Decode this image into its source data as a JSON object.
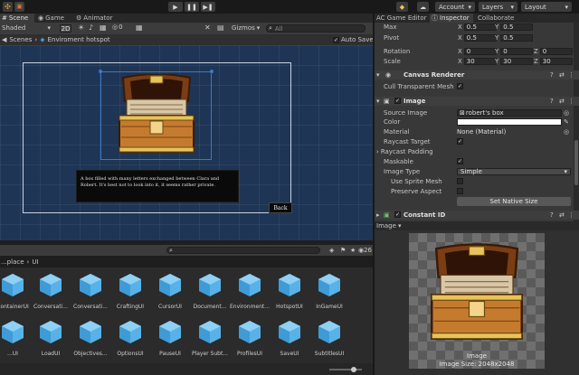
{
  "colors": {
    "accent": "#3a79c4",
    "scene_bg": "#1f3555",
    "panel": "#383838",
    "folder_blue": "#58b2e8"
  },
  "toolbar": {
    "account": "Account",
    "layers": "Layers",
    "layout": "Layout"
  },
  "scene_tabs": {
    "scene": "Scene",
    "game": "Game",
    "animator": "Animator"
  },
  "scene_toolbar": {
    "shading": "Shaded",
    "mode_2d": "2D",
    "hidden_count": "0",
    "gizmos": "Gizmos",
    "search_placeholder": "All"
  },
  "breadcrumb": {
    "scenes": "Scenes",
    "object": "Enviroment hotspot",
    "auto_save": "Auto Save"
  },
  "viewport": {
    "description": "A box filled with many letters exchanged between Clara and Robert. It's best not to look into it, it seems rather private.",
    "back_button": "Back"
  },
  "project": {
    "path_root": "...place",
    "path_child": "UI",
    "count": "26",
    "row1": [
      "ContainerUI",
      "Conversati...",
      "Conversati...",
      "CraftingUI",
      "CursorUI",
      "Document...",
      "Environment...",
      "HotspotUI",
      "InGameUI"
    ],
    "row2": [
      "...UI",
      "LoadUI",
      "Objectives...",
      "OptionsUI",
      "PauseUI",
      "Player Subt...",
      "ProfilesUI",
      "SaveUI",
      "SubtitlesUI"
    ]
  },
  "inspector_tabs": {
    "editor": "AC Game Editor",
    "inspector": "Inspector",
    "collab": "Collaborate"
  },
  "transform": {
    "max_label": "Max",
    "max_x": "0.5",
    "max_y": "0.5",
    "pivot_label": "Pivot",
    "pivot_x": "0.5",
    "pivot_y": "0.5",
    "rotation_label": "Rotation",
    "rot_x": "0",
    "rot_y": "0",
    "rot_z": "0",
    "scale_label": "Scale",
    "scale_x": "30",
    "scale_y": "30",
    "scale_z": "30",
    "x": "X",
    "y": "Y",
    "z": "Z"
  },
  "canvas_renderer": {
    "title": "Canvas Renderer",
    "cull_label": "Cull Transparent Mesh"
  },
  "image": {
    "title": "Image",
    "source_label": "Source Image",
    "source_value": "robert's box",
    "color_label": "Color",
    "material_label": "Material",
    "material_value": "None (Material)",
    "raycast_label": "Raycast Target",
    "padding_label": "Raycast Padding",
    "maskable_label": "Maskable",
    "type_label": "Image Type",
    "type_value": "Simple",
    "sprite_mesh_label": "Use Sprite Mesh",
    "preserve_label": "Preserve Aspect",
    "native_button": "Set Native Size"
  },
  "constant_id": {
    "title": "Constant ID"
  },
  "preview": {
    "header": "Image",
    "caption": "Image",
    "size": "Image Size: 2048x2048"
  }
}
